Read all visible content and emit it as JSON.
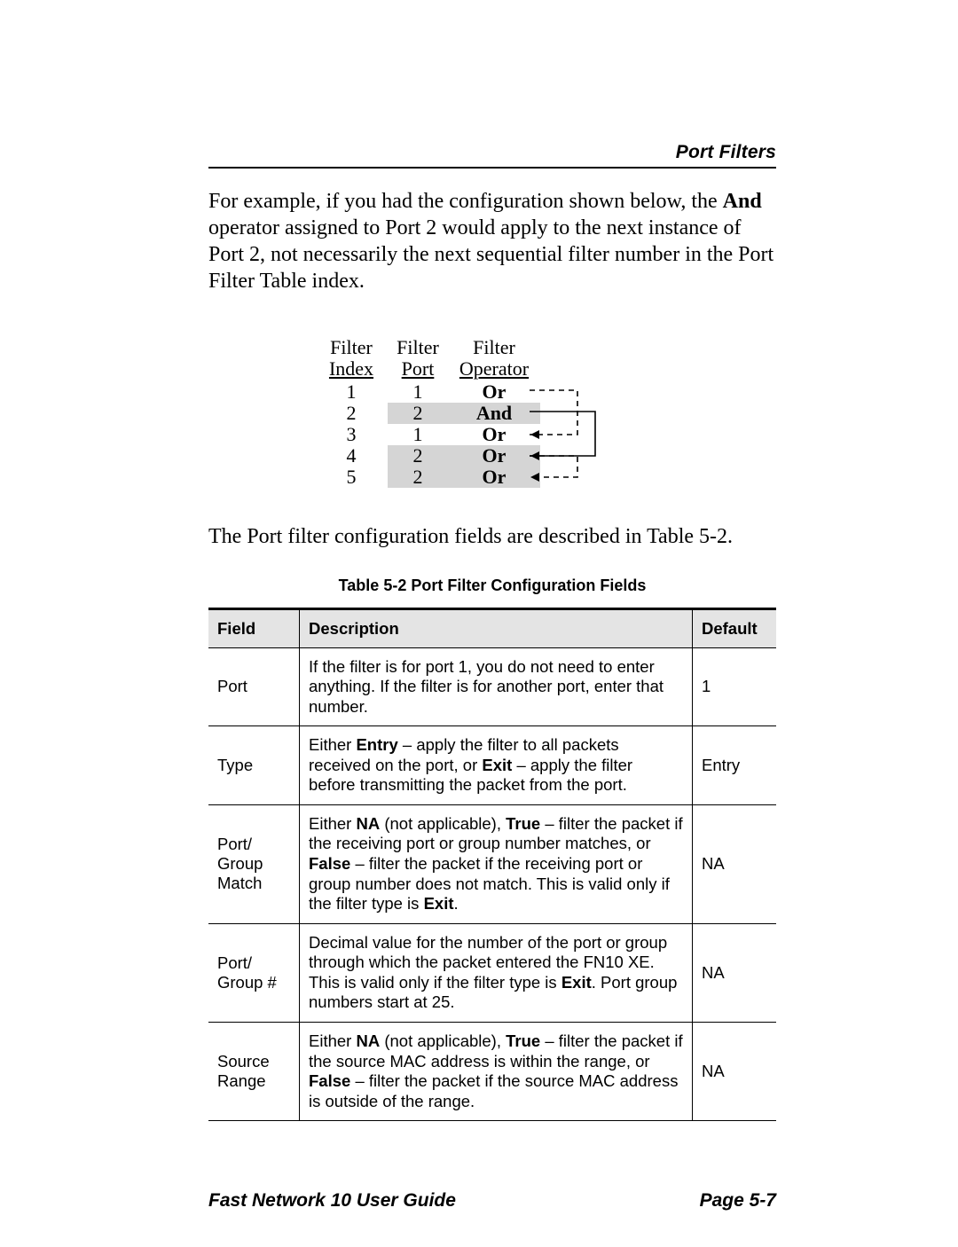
{
  "header": {
    "section_title": "Port Filters"
  },
  "paragraph1": {
    "pre": "For example, if you had the configuration shown below, the ",
    "bold": "And",
    "post": " operator assigned to Port 2 would apply to the next instance of Port 2, not necessarily the next sequential filter number in the Port Filter Table index."
  },
  "example": {
    "col1_l1": "Filter",
    "col1_l2": "Index",
    "col2_l1": "Filter",
    "col2_l2": "Port",
    "col3_l1": "Filter",
    "col3_l2": "Operator",
    "rows": [
      {
        "idx": "1",
        "port": "1",
        "op": "Or",
        "gray": false
      },
      {
        "idx": "2",
        "port": "2",
        "op": "And",
        "gray": true
      },
      {
        "idx": "3",
        "port": "1",
        "op": "Or",
        "gray": false
      },
      {
        "idx": "4",
        "port": "2",
        "op": "Or",
        "gray": true
      },
      {
        "idx": "5",
        "port": "2",
        "op": "Or",
        "gray": true
      }
    ]
  },
  "paragraph2": "The Port filter configuration fields are described in Table 5-2.",
  "table52": {
    "caption": "Table 5-2    Port Filter Configuration Fields",
    "headers": {
      "field": "Field",
      "desc": "Description",
      "def": "Default"
    },
    "rows": [
      {
        "field": "Port",
        "desc_html": "If the filter is for port 1, you do not need to enter anything. If the filter is for another port, enter that number.",
        "def": "1"
      },
      {
        "field": "Type",
        "desc_html": "Either <b>Entry</b> – apply the filter to all packets received on the port, or <b>Exit</b> – apply the filter before transmitting the packet from the port.",
        "def": "Entry"
      },
      {
        "field": "Port/ Group Match",
        "desc_html": "Either <b>NA</b> (not applicable), <b>True</b> – filter the packet if the receiving port or group number matches, or <b>False</b> – filter the packet if the receiving port or group number does not match. This is valid only if the filter type is <b>Exit</b>.",
        "def": "NA"
      },
      {
        "field": "Port/ Group #",
        "desc_html": "Decimal value for the number of the port or group through which the packet entered the FN10 XE. This is valid only if the filter type is <b>Exit</b>. Port group numbers start at 25.",
        "def": "NA"
      },
      {
        "field": "Source Range",
        "desc_html": "Either <b>NA</b> (not applicable), <b>True</b> – filter the packet if the source MAC address is within the range, or <b>False</b> – filter the packet if the source MAC address is outside of the range.",
        "def": "NA"
      }
    ]
  },
  "footer": {
    "left": "Fast Network 10 User Guide",
    "right": "Page 5-7"
  }
}
